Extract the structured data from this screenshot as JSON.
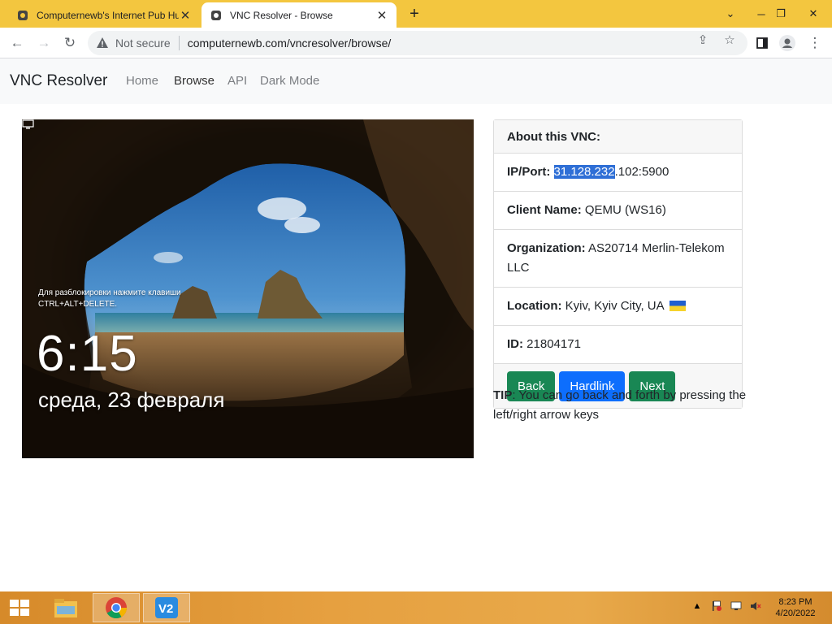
{
  "browser": {
    "tabs": [
      {
        "title": "Computernewb's Internet Pub Hu",
        "active": false
      },
      {
        "title": "VNC Resolver - Browse",
        "active": true
      }
    ],
    "security_label": "Not secure",
    "url": "computernewb.com/vncresolver/browse/"
  },
  "site": {
    "brand": "VNC Resolver",
    "nav": [
      "Home",
      "Browse",
      "API",
      "Dark Mode"
    ],
    "active_nav": "Browse"
  },
  "lockscreen": {
    "hint_line1": "Для разблокировки нажмите клавиши",
    "hint_line2": "CTRL+ALT+DELETE.",
    "time": "6:15",
    "date": "среда, 23 февраля"
  },
  "card": {
    "header": "About this VNC:",
    "ip_label": "IP/Port:",
    "ip_highlighted": "31.128.232",
    "ip_rest": ".102:5900",
    "client_label": "Client Name:",
    "client_value": "QEMU (WS16)",
    "org_label": "Organization:",
    "org_value": "AS20714 Merlin-Telekom LLC",
    "location_label": "Location:",
    "location_value": "Kyiv, Kyiv City, UA",
    "id_label": "ID:",
    "id_value": "21804171",
    "buttons": {
      "back": "Back",
      "hardlink": "Hardlink",
      "next": "Next"
    }
  },
  "tip": {
    "label": "TIP",
    "text": ": You can go back and forth by pressing the left/right arrow keys"
  },
  "taskbar": {
    "time": "8:23 PM",
    "date": "4/20/2022"
  },
  "colors": {
    "titlebar": "#f3c63f",
    "btn_green": "#198754",
    "btn_blue": "#0d6efd",
    "highlight": "#2f6fd6"
  }
}
